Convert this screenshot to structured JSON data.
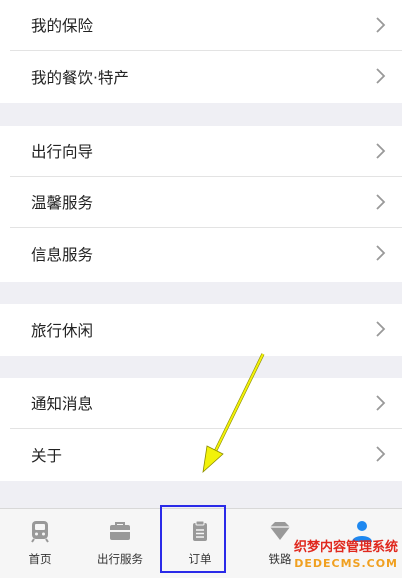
{
  "menu": {
    "group1": [
      "我的保险",
      "我的餐饮·特产"
    ],
    "group2": [
      "出行向导",
      "温馨服务",
      "信息服务"
    ],
    "group3": [
      "旅行休闲"
    ],
    "group4": [
      "通知消息",
      "关于"
    ]
  },
  "tabs": [
    {
      "label": "首页",
      "icon": "train-icon"
    },
    {
      "label": "出行服务",
      "icon": "briefcase-icon"
    },
    {
      "label": "订单",
      "icon": "clipboard-icon"
    },
    {
      "label": "铁路",
      "icon": "diamond-icon"
    },
    {
      "label": "",
      "icon": "person-icon"
    }
  ],
  "watermark": {
    "line1": "织梦内容管理系统",
    "line2": "DEDECMS.COM"
  },
  "colors": {
    "highlight": "#2a2ae8",
    "arrow": "#f2f20a",
    "active_tab": "#1e88f0"
  }
}
